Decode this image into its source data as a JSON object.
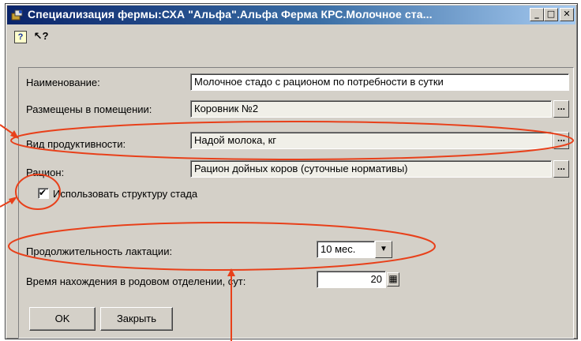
{
  "window": {
    "title": "Специализация фермы:СХА \"Альфа\".Альфа Ферма КРС.Молочное ста...",
    "minimize_symbol": "_",
    "maximize_symbol": "□",
    "close_symbol": "✕"
  },
  "toolbar": {
    "help_icon_symbol": "?",
    "context_help_symbol": "↖?"
  },
  "form": {
    "name_label": "Наименование:",
    "name_value": "Молочное стадо с рационом по потребности в сутки",
    "location_label": "Размещены в помещении:",
    "location_value": "Коровник №2",
    "productivity_label": "Вид продуктивности:",
    "productivity_value": "Надой молока, кг",
    "ration_label": "Рацион:",
    "ration_value": "Рацион дойных коров (суточные нормативы)",
    "ellipsis_symbol": "...",
    "use_structure_label": "Использовать структуру стада",
    "use_structure_checked": true,
    "checkmark_symbol": "✔",
    "lactation_label": "Продолжительность лактации:",
    "lactation_value": "10 мес.",
    "dropdown_symbol": "▼",
    "maternity_label": "Время нахождения в родовом отделении, сут:",
    "maternity_value": "20",
    "calc_symbol": "▦"
  },
  "buttons": {
    "ok_label": "OK",
    "close_label": "Закрыть"
  },
  "annotations": {
    "color": "#e8401a"
  }
}
